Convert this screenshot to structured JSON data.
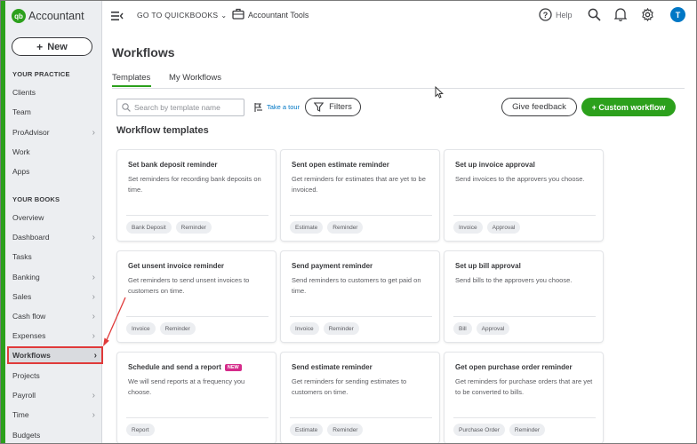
{
  "brand": {
    "logo_text": "qb",
    "name": "Accountant"
  },
  "sidebar": {
    "new_label": "New",
    "sections": [
      {
        "heading": "YOUR PRACTICE"
      },
      {
        "heading": "YOUR BOOKS"
      }
    ],
    "items": [
      {
        "label": "Clients"
      },
      {
        "label": "Team"
      },
      {
        "label": "ProAdvisor"
      },
      {
        "label": "Work"
      },
      {
        "label": "Apps"
      },
      {
        "label": "Overview"
      },
      {
        "label": "Dashboard"
      },
      {
        "label": "Tasks"
      },
      {
        "label": "Banking"
      },
      {
        "label": "Sales"
      },
      {
        "label": "Cash flow"
      },
      {
        "label": "Expenses"
      },
      {
        "label": "Workflows"
      },
      {
        "label": "Projects"
      },
      {
        "label": "Payroll"
      },
      {
        "label": "Time"
      },
      {
        "label": "Budgets"
      }
    ]
  },
  "topbar": {
    "goto_label": "GO TO QUICKBOOKS",
    "accountant_tools": "Accountant Tools",
    "help_label": "Help",
    "avatar_initial": "T"
  },
  "page": {
    "title": "Workflows",
    "tabs": [
      {
        "label": "Templates"
      },
      {
        "label": "My Workflows"
      }
    ],
    "search_placeholder": "Search by template name",
    "tour_label": "Take a tour",
    "filters_label": "Filters",
    "feedback_label": "Give feedback",
    "custom_label": "+ Custom workflow",
    "section_title": "Workflow templates"
  },
  "cards": [
    {
      "title": "Set bank deposit reminder",
      "desc": "Set reminders for recording bank deposits on time.",
      "tags": [
        "Bank Deposit",
        "Reminder"
      ]
    },
    {
      "title": "Sent open estimate reminder",
      "desc": "Get reminders for estimates that are yet to be invoiced.",
      "tags": [
        "Estimate",
        "Reminder"
      ]
    },
    {
      "title": "Set up invoice approval",
      "desc": "Send invoices to the approvers you choose.",
      "tags": [
        "Invoice",
        "Approval"
      ]
    },
    {
      "title": "Get unsent invoice reminder",
      "desc": "Get reminders to send unsent invoices to customers on time.",
      "tags": [
        "Invoice",
        "Reminder"
      ]
    },
    {
      "title": "Send payment reminder",
      "desc": "Send reminders to customers to get paid on time.",
      "tags": [
        "Invoice",
        "Reminder"
      ]
    },
    {
      "title": "Set up bill approval",
      "desc": "Send bills to the approvers you choose.",
      "tags": [
        "Bill",
        "Approval"
      ]
    },
    {
      "title": "Schedule and send a report",
      "badge": "NEW",
      "desc": "We will send reports at a frequency you choose.",
      "tags": [
        "Report"
      ]
    },
    {
      "title": "Send estimate reminder",
      "desc": "Get reminders for sending estimates to customers on time.",
      "tags": [
        "Estimate",
        "Reminder"
      ]
    },
    {
      "title": "Get open purchase order reminder",
      "desc": "Get reminders for purchase orders that are yet to be converted to bills.",
      "tags": [
        "Purchase Order",
        "Reminder"
      ]
    }
  ],
  "colors": {
    "brand_green": "#2ca01c",
    "link_blue": "#0077c5",
    "annotation_red": "#e03a3a",
    "new_badge": "#d52b8a"
  }
}
